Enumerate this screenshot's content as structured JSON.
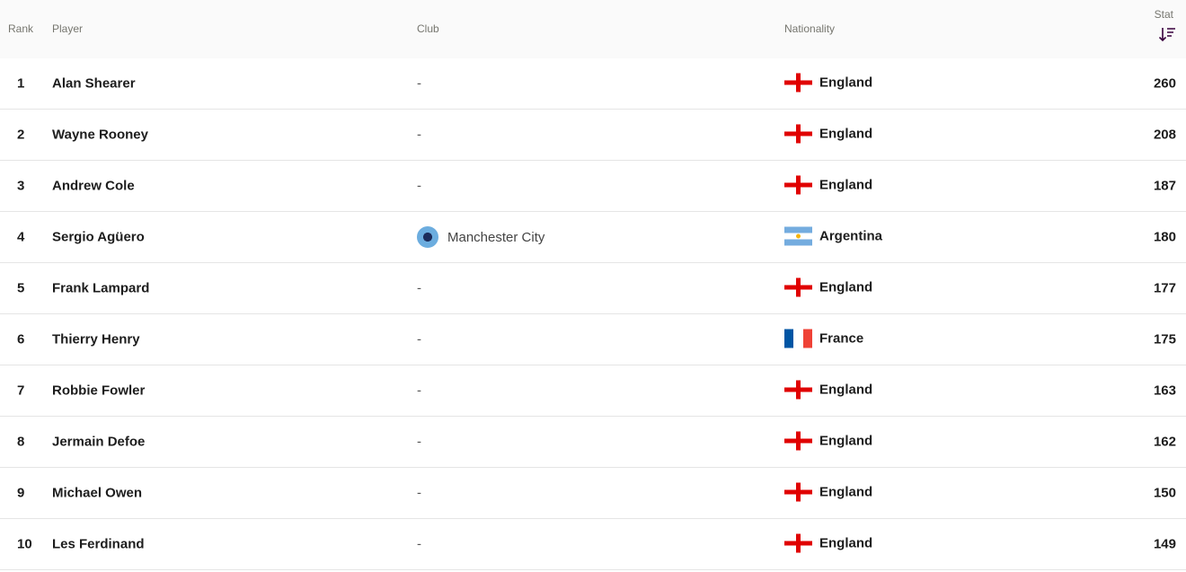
{
  "headers": {
    "rank": "Rank",
    "player": "Player",
    "club": "Club",
    "nationality": "Nationality",
    "stat": "Stat"
  },
  "sort_icon": "sort-descending-icon",
  "rows": [
    {
      "rank": "1",
      "player": "Alan Shearer",
      "club": "-",
      "nationality": "England",
      "flag": "eng",
      "stat": "260"
    },
    {
      "rank": "2",
      "player": "Wayne Rooney",
      "club": "-",
      "nationality": "England",
      "flag": "eng",
      "stat": "208"
    },
    {
      "rank": "3",
      "player": "Andrew Cole",
      "club": "-",
      "nationality": "England",
      "flag": "eng",
      "stat": "187"
    },
    {
      "rank": "4",
      "player": "Sergio Agüero",
      "club": "Manchester City",
      "club_badge": true,
      "nationality": "Argentina",
      "flag": "arg",
      "stat": "180"
    },
    {
      "rank": "5",
      "player": "Frank Lampard",
      "club": "-",
      "nationality": "England",
      "flag": "eng",
      "stat": "177"
    },
    {
      "rank": "6",
      "player": "Thierry Henry",
      "club": "-",
      "nationality": "France",
      "flag": "fra",
      "stat": "175"
    },
    {
      "rank": "7",
      "player": "Robbie Fowler",
      "club": "-",
      "nationality": "England",
      "flag": "eng",
      "stat": "163"
    },
    {
      "rank": "8",
      "player": "Jermain Defoe",
      "club": "-",
      "nationality": "England",
      "flag": "eng",
      "stat": "162"
    },
    {
      "rank": "9",
      "player": "Michael Owen",
      "club": "-",
      "nationality": "England",
      "flag": "eng",
      "stat": "150"
    },
    {
      "rank": "10",
      "player": "Les Ferdinand",
      "club": "-",
      "nationality": "England",
      "flag": "eng",
      "stat": "149"
    }
  ],
  "colors": {
    "header_bg": "#fafafa",
    "header_text": "#76766f",
    "row_border": "#e5e5e5",
    "text": "#1d1d1d"
  }
}
